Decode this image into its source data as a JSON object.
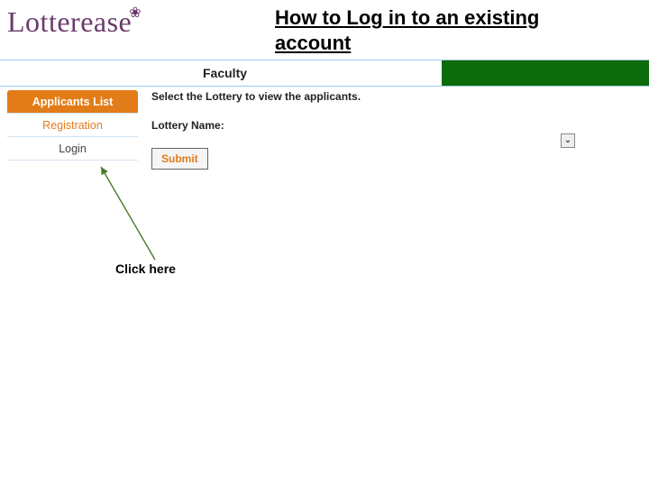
{
  "title": "How to Log in to an existing account",
  "logo": {
    "text": "Lotterease",
    "flower": "❀"
  },
  "bar": {
    "label": "Faculty"
  },
  "sidebar": {
    "items": [
      {
        "label": "Applicants List"
      },
      {
        "label": "Registration"
      },
      {
        "label": "Login"
      }
    ]
  },
  "content": {
    "instruction": "Select the Lottery to view the applicants.",
    "lottery_label": "Lottery Name:",
    "submit_label": "Submit",
    "dropdown_glyph": "⌄"
  },
  "annotation": {
    "click_here": "Click here"
  },
  "colors": {
    "green": "#0c6b0a",
    "orange": "#e27c18",
    "logo": "#6b3a6b"
  }
}
